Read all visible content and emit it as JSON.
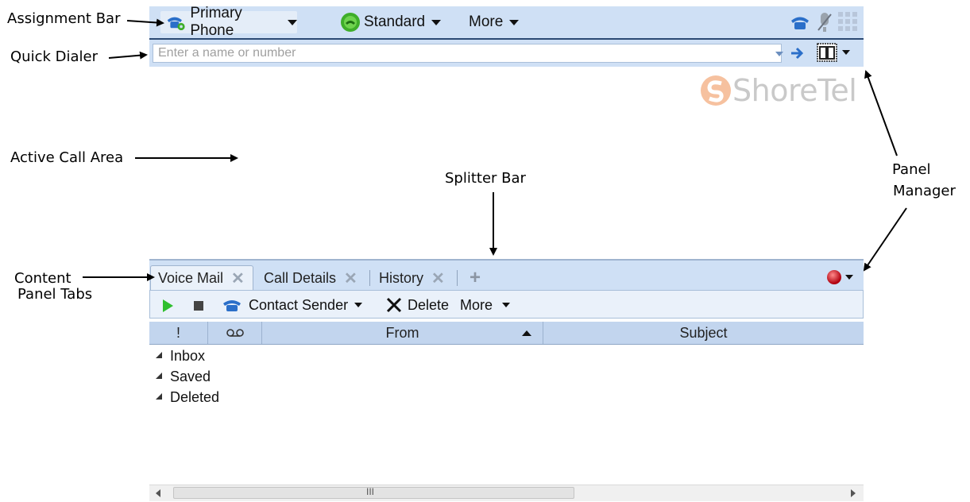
{
  "callouts": {
    "assignment_bar": "Assignment Bar",
    "quick_dialer": "Quick Dialer",
    "active_call_area": "Active Call Area",
    "splitter_bar": "Splitter Bar",
    "panel_manager_line1": "Panel",
    "panel_manager_line2": "Manager",
    "content_tabs_line1": "Content",
    "content_tabs_line2": "Panel Tabs"
  },
  "assignment_bar": {
    "primary_phone": "Primary Phone",
    "availability": "Standard",
    "more": "More"
  },
  "quick_dialer": {
    "placeholder": "Enter a name or number"
  },
  "logo": {
    "text": "ShoreTel"
  },
  "tabs": [
    {
      "label": "Voice Mail",
      "active": true
    },
    {
      "label": "Call Details",
      "active": false
    },
    {
      "label": "History",
      "active": false
    }
  ],
  "toolbar": {
    "contact_sender": "Contact Sender",
    "delete": "Delete",
    "more": "More"
  },
  "grid": {
    "columns": [
      "!",
      "",
      "From",
      "Subject"
    ]
  },
  "folders": [
    "Inbox",
    "Saved",
    "Deleted"
  ],
  "scrollbar": {
    "grip": "III"
  },
  "colors": {
    "bar_blue": "#cfe0f5",
    "status_red": "#d0021b",
    "play_green": "#2fbf2f",
    "phone_blue": "#2b6fc9"
  }
}
